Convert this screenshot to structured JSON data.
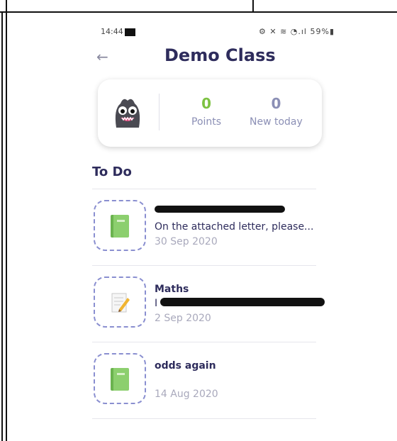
{
  "status_bar": {
    "time": "14:44",
    "right": "⚙ ✕ ≋ ◔.ıl 59%▮"
  },
  "header": {
    "back_glyph": "←",
    "title": "Demo Class"
  },
  "stats": {
    "points_value": "0",
    "points_label": "Points",
    "new_value": "0",
    "new_label": "New today"
  },
  "todo": {
    "heading": "To Do",
    "items": [
      {
        "icon": "book-icon",
        "name": "",
        "description": "On the attached letter, please...",
        "date": "30 Sep 2020"
      },
      {
        "icon": "notepad-icon",
        "name": "Maths",
        "description": "I",
        "date": "2 Sep 2020"
      },
      {
        "icon": "book-icon",
        "name": "odds again",
        "description": "",
        "date": "14 Aug 2020"
      }
    ]
  },
  "colors": {
    "title": "#2e2c5c",
    "points": "#7dc242",
    "muted": "#8b8fb5",
    "dashed_border": "#8a8fd0"
  }
}
